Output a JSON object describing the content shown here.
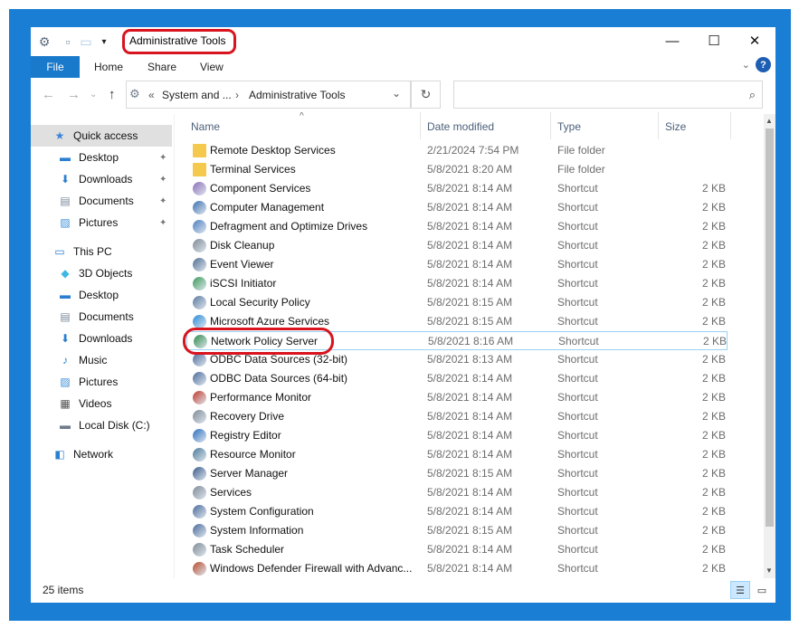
{
  "window": {
    "title": "Administrative Tools",
    "minimize_glyph": "—",
    "maximize_glyph": "☐",
    "close_glyph": "✕"
  },
  "ribbon": {
    "tabs": [
      "File",
      "Home",
      "Share",
      "View"
    ],
    "help_label": "?",
    "expand_glyph": "⌄"
  },
  "address": {
    "breadcrumb_prefix": "«",
    "segments": [
      "System and ...",
      "Administrative Tools"
    ],
    "separator": "›",
    "dropdown_glyph": "⌄",
    "refresh_glyph": "↻",
    "search_placeholder": ""
  },
  "nav": {
    "back_glyph": "←",
    "forward_glyph": "→",
    "recent_glyph": "⌄",
    "up_glyph": "↑"
  },
  "sidebar": {
    "items": [
      {
        "label": "Quick access",
        "icon": "star-icon",
        "color": "#3c84d6",
        "pinned": false
      },
      {
        "label": "Desktop",
        "icon": "desktop-icon",
        "color": "#2a7fd1",
        "pinned": true
      },
      {
        "label": "Downloads",
        "icon": "download-arrow-icon",
        "color": "#2a7fd1",
        "pinned": true
      },
      {
        "label": "Documents",
        "icon": "document-icon",
        "color": "#7a8a9a",
        "pinned": true
      },
      {
        "label": "Pictures",
        "icon": "pictures-icon",
        "color": "#3a8fd8",
        "pinned": true
      },
      {
        "label": "This PC",
        "icon": "computer-icon",
        "color": "#2a7fd1",
        "pinned": false
      },
      {
        "label": "3D Objects",
        "icon": "cube-icon",
        "color": "#3fb7e3",
        "pinned": false
      },
      {
        "label": "Desktop",
        "icon": "desktop-icon",
        "color": "#2a7fd1",
        "pinned": false
      },
      {
        "label": "Documents",
        "icon": "document-icon",
        "color": "#7a8a9a",
        "pinned": false
      },
      {
        "label": "Downloads",
        "icon": "download-arrow-icon",
        "color": "#2a7fd1",
        "pinned": false
      },
      {
        "label": "Music",
        "icon": "music-note-icon",
        "color": "#2a7fd1",
        "pinned": false
      },
      {
        "label": "Pictures",
        "icon": "pictures-icon",
        "color": "#3a8fd8",
        "pinned": false
      },
      {
        "label": "Videos",
        "icon": "film-icon",
        "color": "#555555",
        "pinned": false
      },
      {
        "label": "Local Disk (C:)",
        "icon": "drive-icon",
        "color": "#6f7d8b",
        "pinned": false
      },
      {
        "label": "Network",
        "icon": "network-icon",
        "color": "#2a7fd1",
        "pinned": false
      }
    ]
  },
  "columns": {
    "name": "Name",
    "date": "Date modified",
    "type": "Type",
    "size": "Size",
    "sort_glyph": "^"
  },
  "files": [
    {
      "name": "Remote Desktop Services",
      "date": "2/21/2024 7:54 PM",
      "type": "File folder",
      "size": "",
      "icon": "folder-icon",
      "color": "#f5c94d"
    },
    {
      "name": "Terminal Services",
      "date": "5/8/2021 8:20 AM",
      "type": "File folder",
      "size": "",
      "icon": "folder-icon",
      "color": "#f5c94d"
    },
    {
      "name": "Component Services",
      "date": "5/8/2021 8:14 AM",
      "type": "Shortcut",
      "size": "2 KB",
      "icon": "component-services-icon",
      "color": "#8a6fb8"
    },
    {
      "name": "Computer Management",
      "date": "5/8/2021 8:14 AM",
      "type": "Shortcut",
      "size": "2 KB",
      "icon": "computer-management-icon",
      "color": "#3a6fb0"
    },
    {
      "name": "Defragment and Optimize Drives",
      "date": "5/8/2021 8:14 AM",
      "type": "Shortcut",
      "size": "2 KB",
      "icon": "defragment-icon",
      "color": "#4a7fc0"
    },
    {
      "name": "Disk Cleanup",
      "date": "5/8/2021 8:14 AM",
      "type": "Shortcut",
      "size": "2 KB",
      "icon": "disk-cleanup-icon",
      "color": "#7d8a96"
    },
    {
      "name": "Event Viewer",
      "date": "5/8/2021 8:14 AM",
      "type": "Shortcut",
      "size": "2 KB",
      "icon": "event-viewer-icon",
      "color": "#4f6f94"
    },
    {
      "name": "iSCSI Initiator",
      "date": "5/8/2021 8:14 AM",
      "type": "Shortcut",
      "size": "2 KB",
      "icon": "iscsi-icon",
      "color": "#3a9a5a"
    },
    {
      "name": "Local Security Policy",
      "date": "5/8/2021 8:15 AM",
      "type": "Shortcut",
      "size": "2 KB",
      "icon": "security-policy-icon",
      "color": "#5a7aa0"
    },
    {
      "name": "Microsoft Azure Services",
      "date": "5/8/2021 8:15 AM",
      "type": "Shortcut",
      "size": "2 KB",
      "icon": "azure-icon",
      "color": "#2a8ad8"
    },
    {
      "name": "Network Policy Server",
      "date": "5/8/2021 8:16 AM",
      "type": "Shortcut",
      "size": "2 KB",
      "icon": "network-policy-icon",
      "color": "#2f8a4a"
    },
    {
      "name": "ODBC Data Sources (32-bit)",
      "date": "5/8/2021 8:13 AM",
      "type": "Shortcut",
      "size": "2 KB",
      "icon": "odbc-icon",
      "color": "#4a6a9a"
    },
    {
      "name": "ODBC Data Sources (64-bit)",
      "date": "5/8/2021 8:14 AM",
      "type": "Shortcut",
      "size": "2 KB",
      "icon": "odbc-icon",
      "color": "#4a6a9a"
    },
    {
      "name": "Performance Monitor",
      "date": "5/8/2021 8:14 AM",
      "type": "Shortcut",
      "size": "2 KB",
      "icon": "performance-monitor-icon",
      "color": "#c0392b"
    },
    {
      "name": "Recovery Drive",
      "date": "5/8/2021 8:14 AM",
      "type": "Shortcut",
      "size": "2 KB",
      "icon": "recovery-drive-icon",
      "color": "#7d8a96"
    },
    {
      "name": "Registry Editor",
      "date": "5/8/2021 8:14 AM",
      "type": "Shortcut",
      "size": "2 KB",
      "icon": "registry-editor-icon",
      "color": "#2a6fc0"
    },
    {
      "name": "Resource Monitor",
      "date": "5/8/2021 8:14 AM",
      "type": "Shortcut",
      "size": "2 KB",
      "icon": "resource-monitor-icon",
      "color": "#4a7a9a"
    },
    {
      "name": "Server Manager",
      "date": "5/8/2021 8:15 AM",
      "type": "Shortcut",
      "size": "2 KB",
      "icon": "server-manager-icon",
      "color": "#3a5a8a"
    },
    {
      "name": "Services",
      "date": "5/8/2021 8:14 AM",
      "type": "Shortcut",
      "size": "2 KB",
      "icon": "services-gear-icon",
      "color": "#7d8a96"
    },
    {
      "name": "System Configuration",
      "date": "5/8/2021 8:14 AM",
      "type": "Shortcut",
      "size": "2 KB",
      "icon": "system-configuration-icon",
      "color": "#4a6a9a"
    },
    {
      "name": "System Information",
      "date": "5/8/2021 8:15 AM",
      "type": "Shortcut",
      "size": "2 KB",
      "icon": "system-information-icon",
      "color": "#4a6a9a"
    },
    {
      "name": "Task Scheduler",
      "date": "5/8/2021 8:14 AM",
      "type": "Shortcut",
      "size": "2 KB",
      "icon": "task-scheduler-icon",
      "color": "#7d8a96"
    },
    {
      "name": "Windows Defender Firewall with Advanc...",
      "date": "5/8/2021 8:14 AM",
      "type": "Shortcut",
      "size": "2 KB",
      "icon": "firewall-icon",
      "color": "#b84a2a"
    }
  ],
  "status": {
    "item_count": "25 items"
  },
  "colors": {
    "frame_blue": "#1a7fd4",
    "file_tab": "#1979ca",
    "highlight_red": "#d8141e",
    "hover_border": "#99d1f6"
  }
}
